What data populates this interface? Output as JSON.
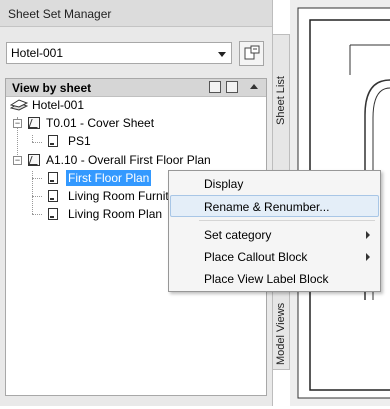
{
  "panel": {
    "title": "Sheet Set Manager",
    "sheet_set_select": "Hotel-001",
    "view_header": "View by sheet",
    "tabs": [
      "Sheet List",
      "Model Views"
    ]
  },
  "tree": {
    "root": "Hotel-001",
    "t001": "T0.01 - Cover Sheet",
    "ps1": "PS1",
    "a110": "A1.10 - Overall First Floor Plan",
    "first_floor": "First Floor Plan",
    "living_furn": "Living Room Furnit",
    "living_plan": "Living Room Plan"
  },
  "context_menu": {
    "display": "Display",
    "rename": "Rename & Renumber...",
    "set_category": "Set category",
    "place_callout": "Place Callout Block",
    "place_view_label": "Place View Label Block"
  }
}
